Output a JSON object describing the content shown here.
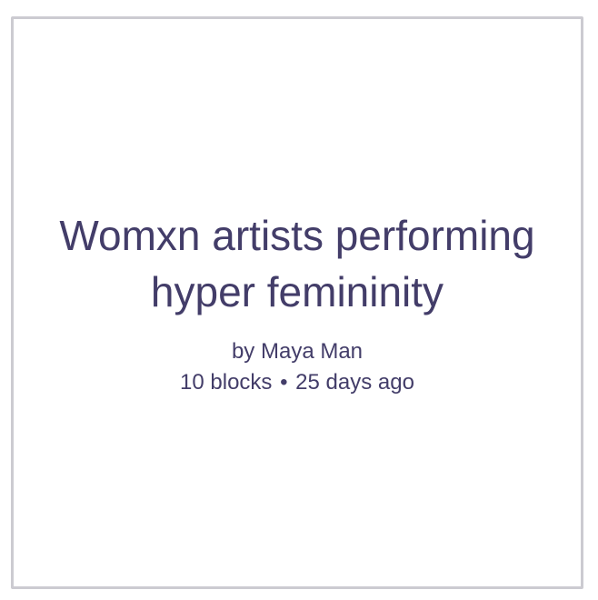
{
  "channel": {
    "title_line1": "Womxn artists performing",
    "title_line2": "hyper femininity",
    "author_prefix": "by",
    "author_name": "Maya Man",
    "block_count": "10 blocks",
    "separator": "•",
    "updated": "25 days ago"
  },
  "colors": {
    "text": "#433d69",
    "border": "#cccbd1",
    "background": "#ffffff"
  }
}
